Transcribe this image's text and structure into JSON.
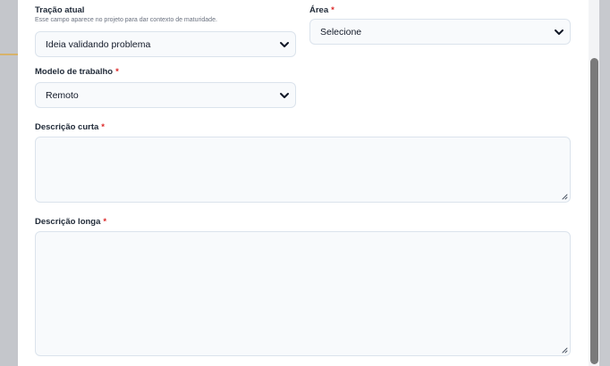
{
  "form": {
    "tracao": {
      "label": "Tração atual",
      "help": "Esse campo aparece no projeto para dar contexto de maturidade.",
      "value": "Ideia validando problema"
    },
    "area": {
      "label": "Área",
      "required_mark": "*",
      "value": "Selecione"
    },
    "modelo": {
      "label": "Modelo de trabalho",
      "required_mark": "*",
      "value": "Remoto"
    },
    "descricao_curta": {
      "label": "Descrição curta",
      "required_mark": "*",
      "value": ""
    },
    "descricao_longa": {
      "label": "Descrição longa",
      "required_mark": "*",
      "value": ""
    }
  },
  "icons": {
    "select_arrow": "chevron-down-icon",
    "resize": "resize-grip-icon"
  },
  "colors": {
    "required": "#dc2626",
    "field_bg": "#f8fafc",
    "field_border": "#dbe3ec",
    "scrollbar": "#7a7a7a"
  }
}
